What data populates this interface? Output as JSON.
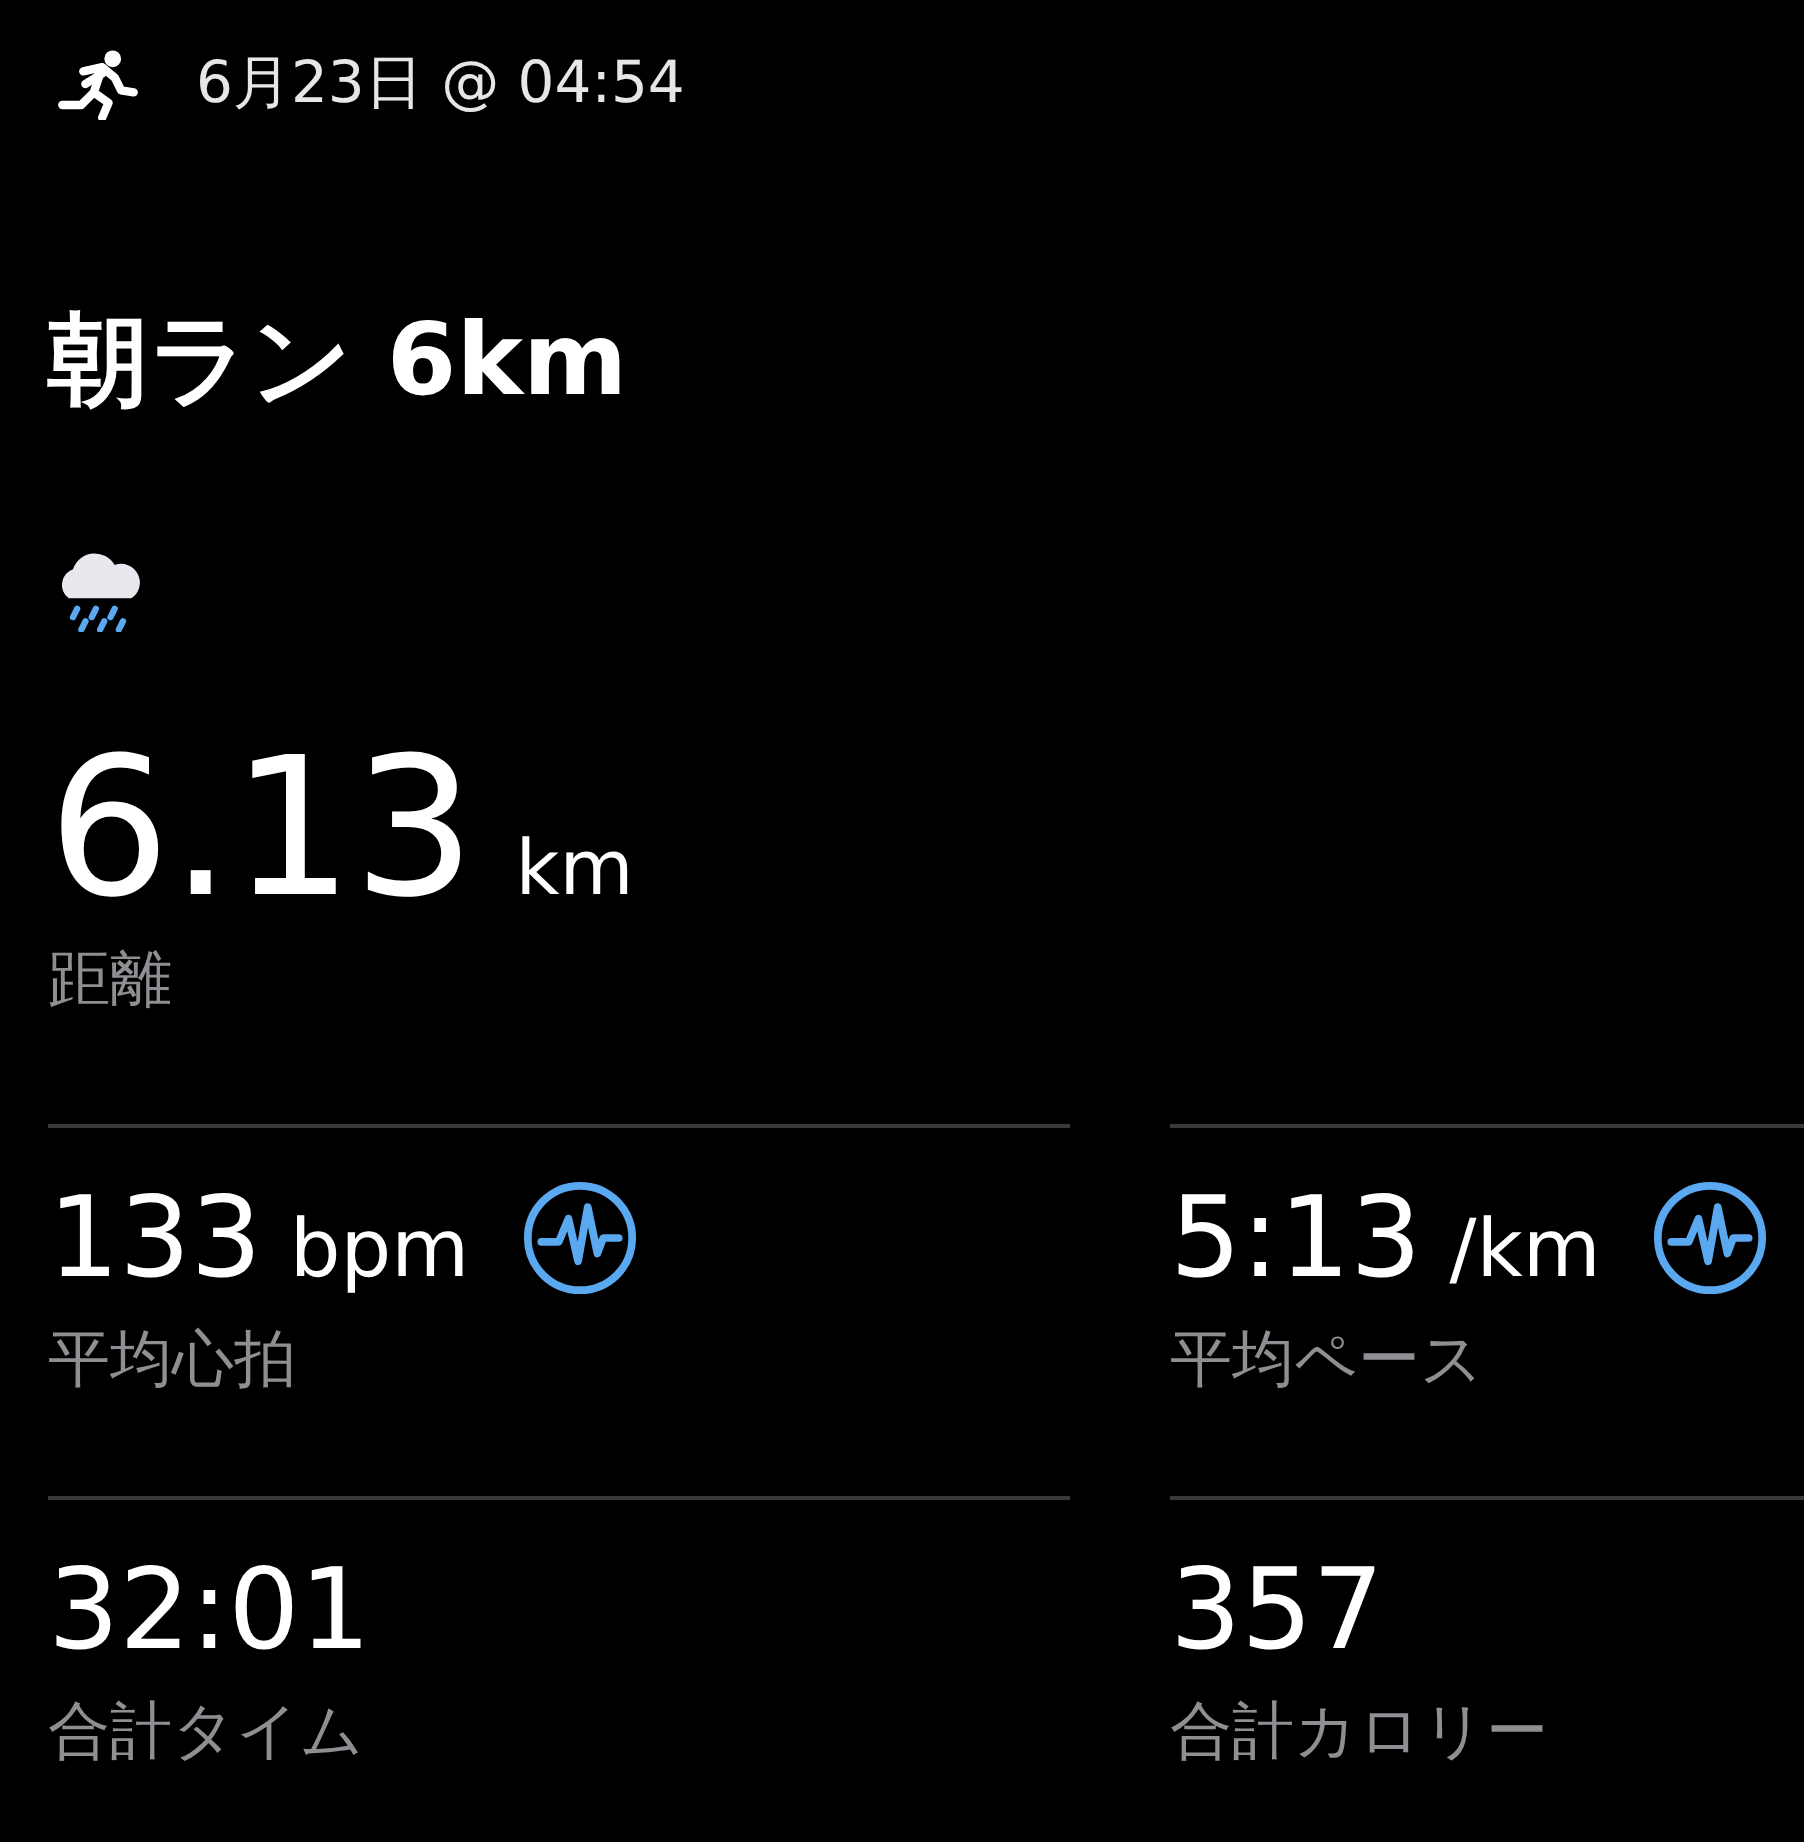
{
  "header": {
    "date_time": "6月23日 @ 04:54"
  },
  "title": "朝ラン 6km",
  "distance": {
    "value": "6.13",
    "unit": "km",
    "label": "距離"
  },
  "metrics": [
    {
      "value": "133",
      "unit": "bpm",
      "label": "平均心拍",
      "kind": "chart"
    },
    {
      "value": "5:13",
      "unit": "/km",
      "label": "平均ペース",
      "kind": "chart"
    },
    {
      "value": "32:01",
      "label": "合計タイム",
      "kind": "plain"
    },
    {
      "value": "357",
      "label": "合計カロリー",
      "kind": "plain"
    }
  ]
}
